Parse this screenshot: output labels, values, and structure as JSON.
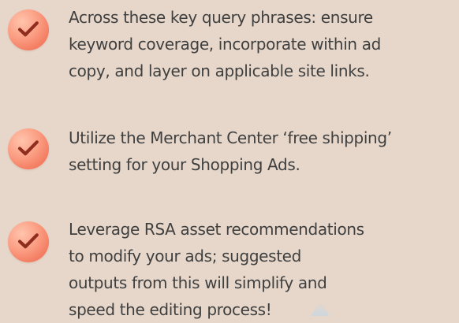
{
  "checklist": {
    "items": [
      {
        "icon": "check-icon",
        "lines": [
          "Across these key query phrases: ensure",
          "keyword coverage, incorporate within ad",
          "copy, and layer on applicable site links."
        ]
      },
      {
        "icon": "check-icon",
        "lines": [
          "Utilize the Merchant Center ‘free shipping’",
          "setting for your Shopping Ads."
        ]
      },
      {
        "icon": "check-icon",
        "lines": [
          "Leverage RSA asset recommendations",
          "to modify your ads; suggested",
          "outputs from this will simplify and",
          "speed the editing process!"
        ]
      }
    ]
  },
  "colors": {
    "background": "#e6d7ca",
    "text": "#3f3f3f",
    "badge": "#f47f64",
    "check": "#8f2d1f"
  }
}
